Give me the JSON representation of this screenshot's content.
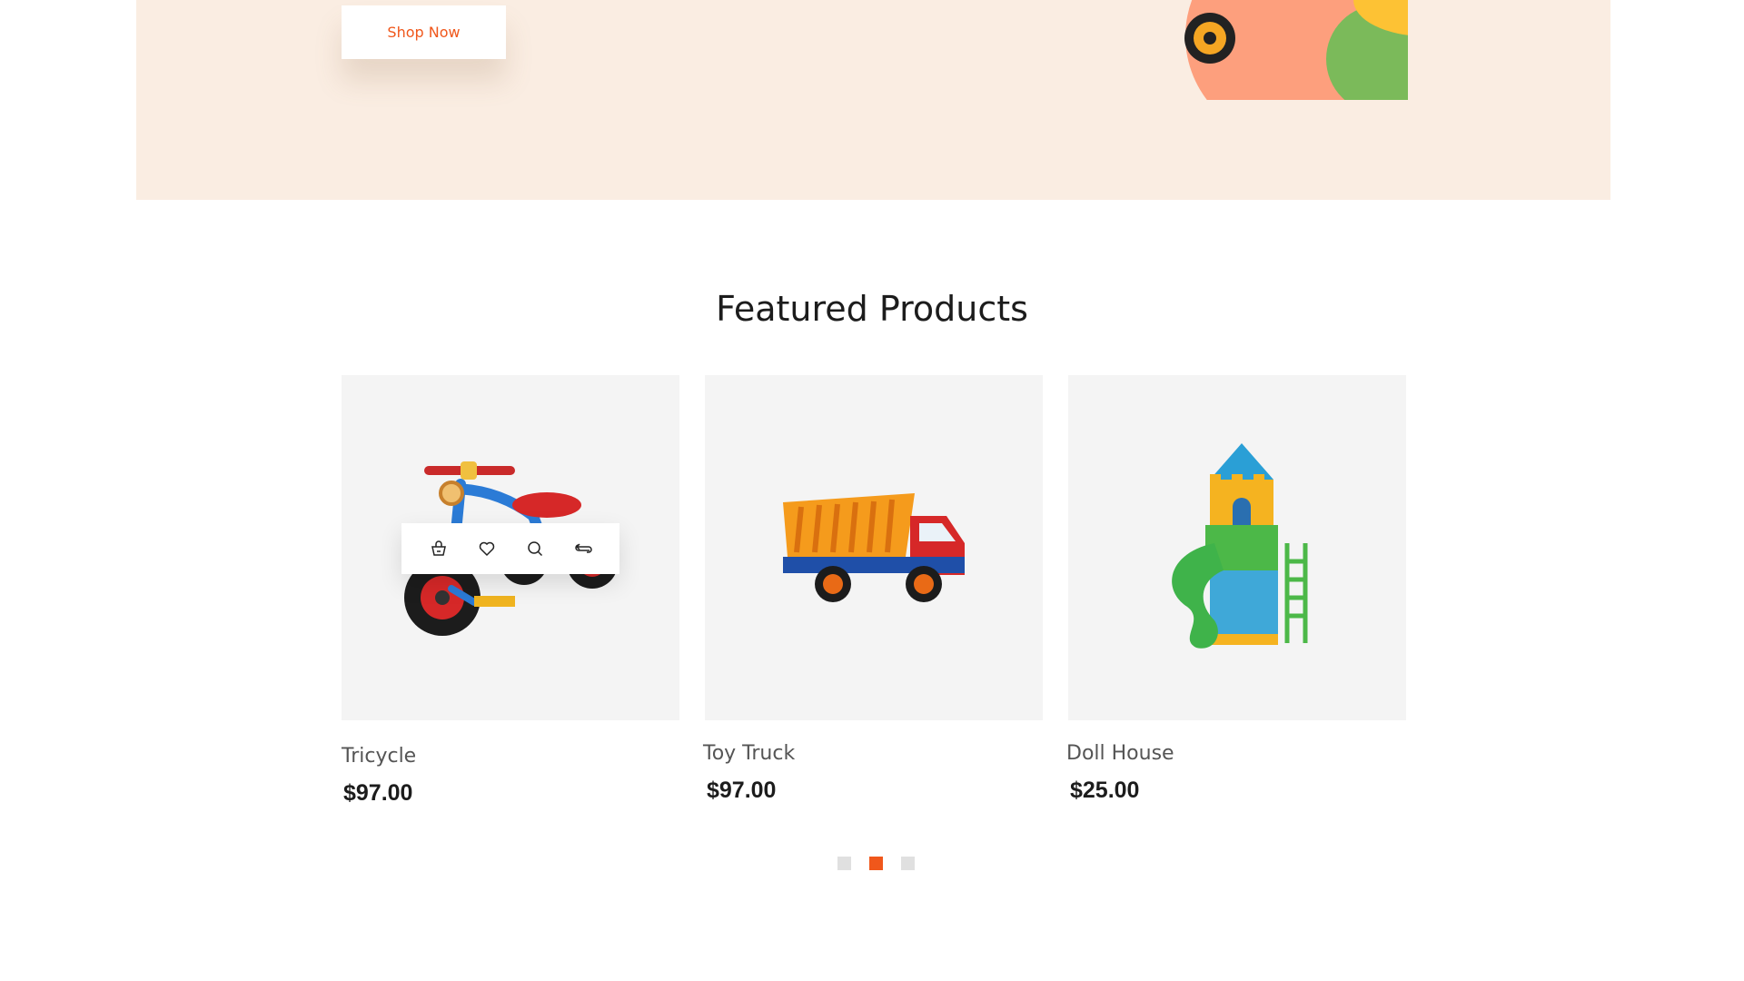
{
  "hero": {
    "shop_button_label": "Shop Now"
  },
  "featured": {
    "title": "Featured Products",
    "products": [
      {
        "name": "Tricycle",
        "price": "$97.00",
        "image_icon": "tricycle-icon"
      },
      {
        "name": "Toy Truck",
        "price": "$97.00",
        "image_icon": "dump-truck-icon"
      },
      {
        "name": "Doll House",
        "price": "$25.00",
        "image_icon": "castle-slide-icon"
      }
    ],
    "actions": [
      "add-to-cart-icon",
      "wishlist-heart-icon",
      "quick-view-search-icon",
      "compare-icon"
    ]
  },
  "carousel": {
    "page_count": 3,
    "active_page": 2
  },
  "colors": {
    "accent": "#f0571b",
    "hero_bg": "#faede2",
    "card_bg": "#f4f4f4"
  }
}
